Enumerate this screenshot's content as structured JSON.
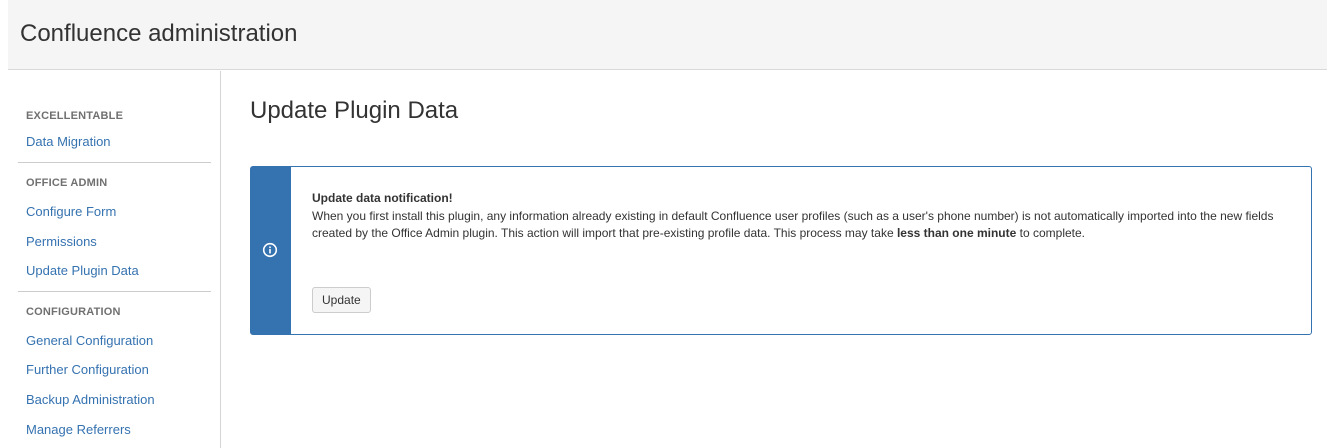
{
  "header": {
    "title": "Confluence administration"
  },
  "sidebar": {
    "sections": [
      {
        "heading": "EXCELLENTABLE",
        "items": [
          {
            "label": "Data Migration"
          }
        ]
      },
      {
        "heading": "OFFICE ADMIN",
        "items": [
          {
            "label": "Configure Form"
          },
          {
            "label": "Permissions"
          },
          {
            "label": "Update Plugin Data"
          }
        ]
      },
      {
        "heading": "CONFIGURATION",
        "items": [
          {
            "label": "General Configuration"
          },
          {
            "label": "Further Configuration"
          },
          {
            "label": "Backup Administration"
          },
          {
            "label": "Manage Referrers"
          }
        ]
      }
    ]
  },
  "main": {
    "title": "Update Plugin Data",
    "notice": {
      "icon": "info-icon",
      "title": "Update data notification!",
      "body_text": "When you first install this plugin, any information already existing in default Confluence user profiles (such as a user's phone number) is not automatically imported into the new fields created by the Office Admin plugin. This action will import that pre-existing profile data. This process may take ",
      "body_bold": "less than one minute",
      "body_end": " to complete.",
      "button_label": "Update"
    }
  },
  "colors": {
    "accent": "#3572b0",
    "header_bg": "#f5f5f5",
    "link": "#3572b0"
  }
}
